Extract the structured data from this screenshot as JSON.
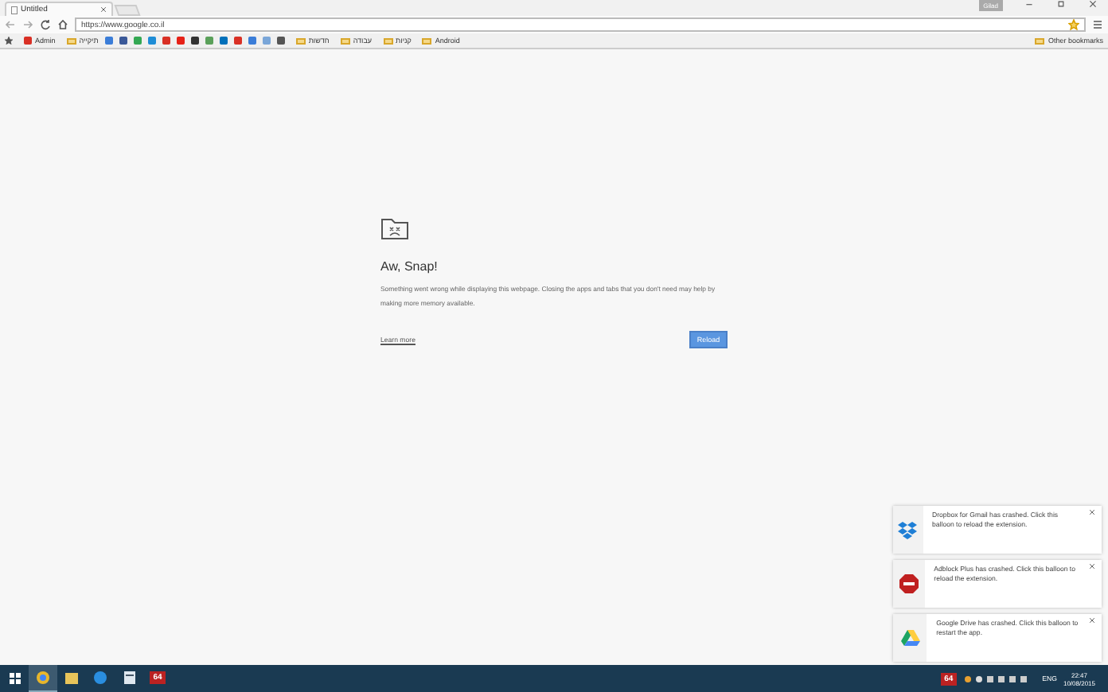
{
  "window": {
    "tab_title": "Untitled",
    "profile": "Gilad"
  },
  "toolbar": {
    "url": "https://www.google.co.il"
  },
  "lead_bookmark": {
    "label": "Admin",
    "color": "#d93025"
  },
  "lead_folder": {
    "label": "תיקייה"
  },
  "bookmarks": [
    {
      "kind": "site",
      "color": "#3b7dd8"
    },
    {
      "kind": "site",
      "color": "#3b5998"
    },
    {
      "kind": "site",
      "color": "#34a853"
    },
    {
      "kind": "site",
      "color": "#1f8dd6"
    },
    {
      "kind": "site",
      "color": "#d93025"
    },
    {
      "kind": "site",
      "color": "#e62117"
    },
    {
      "kind": "site",
      "color": "#333333"
    },
    {
      "kind": "site",
      "color": "#5aa05a"
    },
    {
      "kind": "site",
      "color": "#0070ba"
    },
    {
      "kind": "site",
      "color": "#d93025"
    },
    {
      "kind": "site",
      "color": "#3b7dd8"
    },
    {
      "kind": "site",
      "color": "#7aa6d8"
    },
    {
      "kind": "site",
      "color": "#555555"
    }
  ],
  "folder_news": {
    "label": "חדשות"
  },
  "folder_work": {
    "label": "עבודה"
  },
  "folder_shopping": {
    "label": "קניות"
  },
  "folder_android": {
    "label": "Android"
  },
  "other_bookmarks": "Other bookmarks",
  "error": {
    "title": "Aw, Snap!",
    "message": "Something went wrong while displaying this webpage. Closing the apps and tabs that you don't need may help by making more memory available.",
    "link": "Learn more",
    "button": "Reload"
  },
  "notifications": [
    {
      "kind": "dropbox",
      "text": "Dropbox for Gmail has crashed. Click this balloon to reload the extension."
    },
    {
      "kind": "abp",
      "text": "Adblock Plus has crashed. Click this balloon to reload the extension."
    },
    {
      "kind": "drive",
      "text": "Google Drive has crashed. Click this balloon to restart the app."
    }
  ],
  "taskbar": {
    "apps": [
      {
        "kind": "chrome",
        "selected": true
      },
      {
        "kind": "files",
        "selected": false
      },
      {
        "kind": "edge",
        "selected": false
      },
      {
        "kind": "doc",
        "selected": false
      },
      {
        "kind": "badge",
        "label": "64",
        "selected": false
      }
    ],
    "tray_badge": "64",
    "language": "ENG",
    "time": "22:47",
    "date": "10/08/2015"
  }
}
